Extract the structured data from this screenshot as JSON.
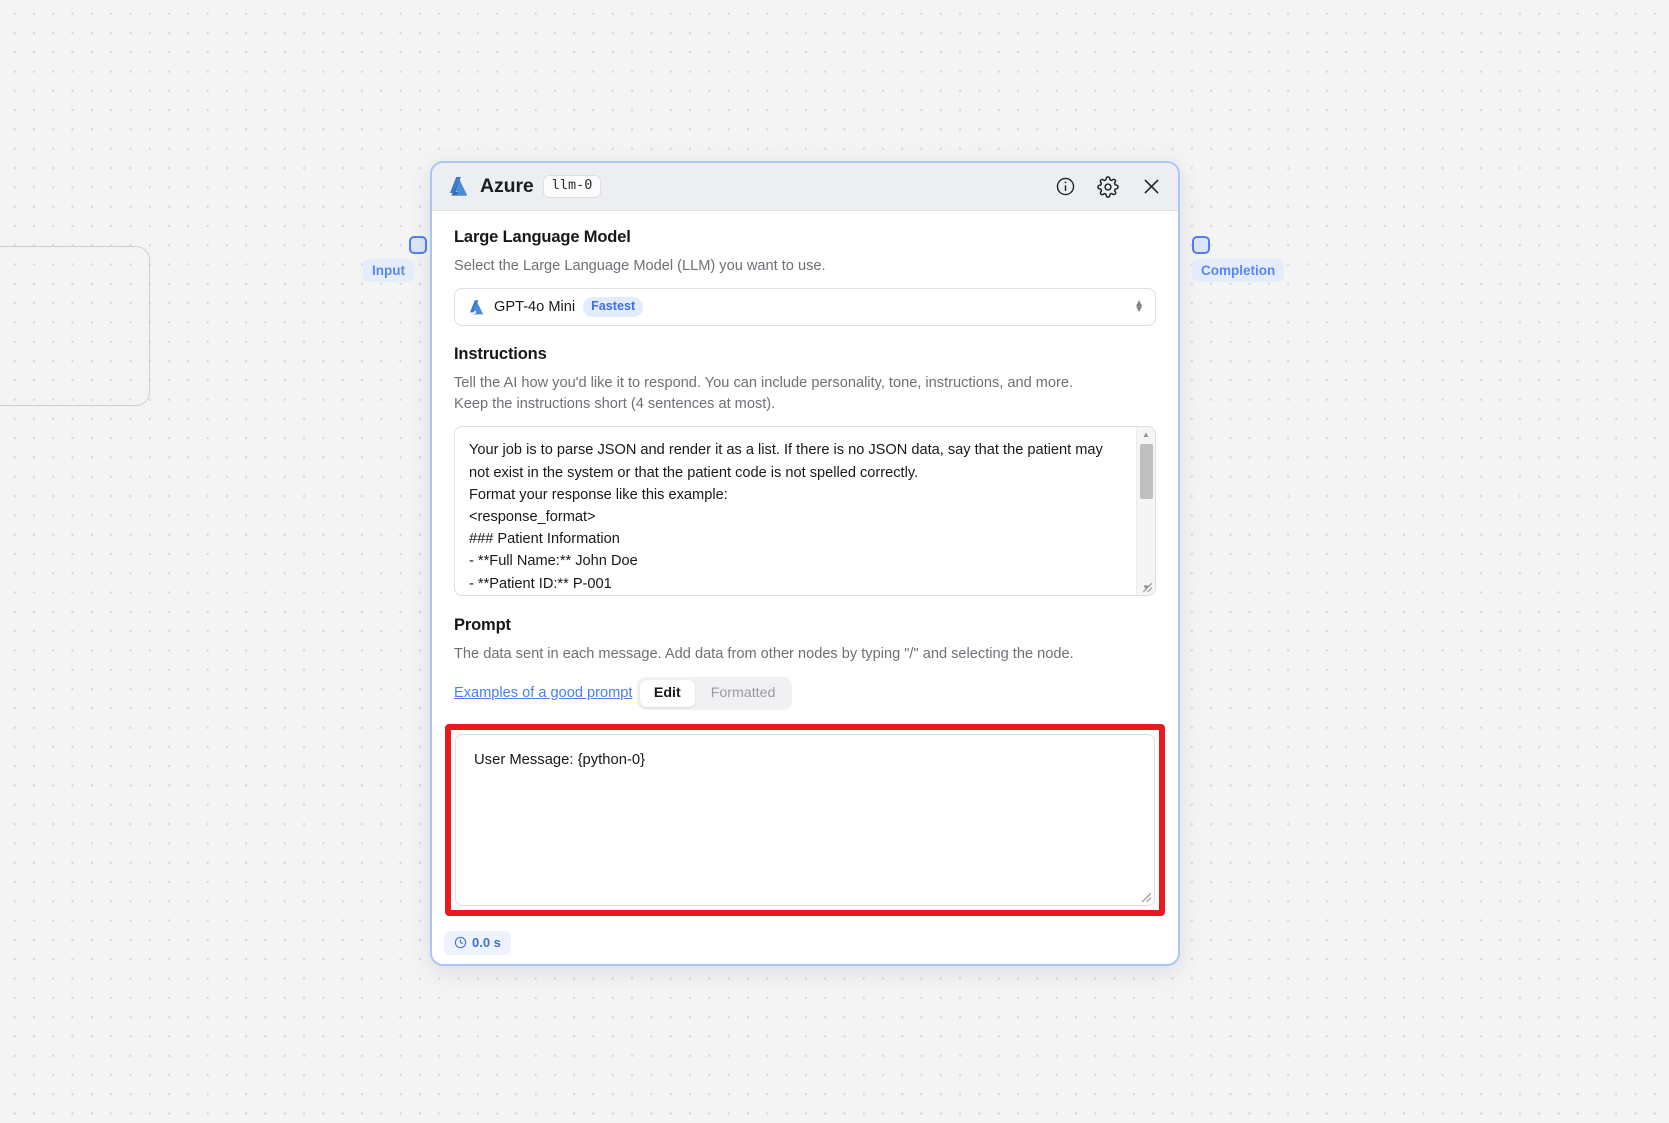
{
  "canvas": {
    "background_color": "#f4f4f5",
    "dot_color": "#d9d9dd"
  },
  "ports": {
    "input": {
      "label": "Input",
      "color": "#4f7ff0"
    },
    "output": {
      "label": "Completion",
      "color": "#4f7ff0"
    }
  },
  "node": {
    "header": {
      "logo_icon": "azure-logo-icon",
      "title": "Azure",
      "id_badge": "llm-0",
      "info_icon": "info-icon",
      "settings_icon": "gear-icon",
      "close_icon": "close-icon"
    },
    "model_section": {
      "title": "Large Language Model",
      "description": "Select the Large Language Model (LLM) you want to use.",
      "selected_model": "GPT-4o Mini",
      "model_badge": "Fastest",
      "model_badge_color": "#3d6fe0",
      "model_logo_icon": "azure-logo-icon",
      "caret_icon": "chevron-updown-icon"
    },
    "instructions_section": {
      "title": "Instructions",
      "description": "Tell the AI how you'd like it to respond. You can include personality, tone, instructions, and more. Keep the instructions short (4 sentences at most).",
      "value": "Your job is to parse JSON and render it as a list. If there is no JSON data, say that the patient may not exist in the system or that the patient code is not spelled correctly.\nFormat your response like this example:\n<response_format>\n### Patient Information\n- **Full Name:** John Doe\n- **Patient ID:** P-001"
    },
    "prompt_section": {
      "title": "Prompt",
      "description": "The data sent in each message. Add data from other nodes by typing \"/\" and selecting the node.",
      "link_label": "Examples of a good prompt",
      "tabs": [
        {
          "label": "Edit",
          "active": true
        },
        {
          "label": "Formatted",
          "active": false
        }
      ],
      "value": "User Message: {python-0}",
      "highlight_color": "#e8191c"
    },
    "footer": {
      "timer_icon": "clock-icon",
      "timer_label": "0.0 s",
      "timer_color": "#3c6ede"
    }
  }
}
